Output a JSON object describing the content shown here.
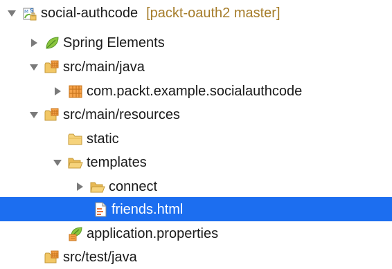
{
  "tree": {
    "project": {
      "label": "social-authcode",
      "decoration": "[packt-oauth2 master]",
      "icon": "spring-project-icon"
    },
    "items": [
      {
        "label": "Spring Elements",
        "icon": "spring-leaf-icon",
        "expanded": false
      },
      {
        "label": "src/main/java",
        "icon": "source-folder-icon",
        "expanded": true
      },
      {
        "label": "com.packt.example.socialauthcode",
        "icon": "package-icon",
        "expanded": false
      },
      {
        "label": "src/main/resources",
        "icon": "source-folder-icon",
        "expanded": true
      },
      {
        "label": "static",
        "icon": "folder-icon",
        "expanded": null
      },
      {
        "label": "templates",
        "icon": "folder-open-icon",
        "expanded": true
      },
      {
        "label": "connect",
        "icon": "folder-icon",
        "expanded": false
      },
      {
        "label": "friends.html",
        "icon": "html-file-icon",
        "selected": true
      },
      {
        "label": "application.properties",
        "icon": "spring-properties-icon"
      },
      {
        "label": "src/test/java",
        "icon": "source-folder-icon"
      }
    ]
  },
  "colors": {
    "selection": "#1c6ef0",
    "decoration": "#a67d2b",
    "twisty": "#7a7a7a",
    "folder": "#f2c765",
    "spring_green": "#6ab43e"
  }
}
